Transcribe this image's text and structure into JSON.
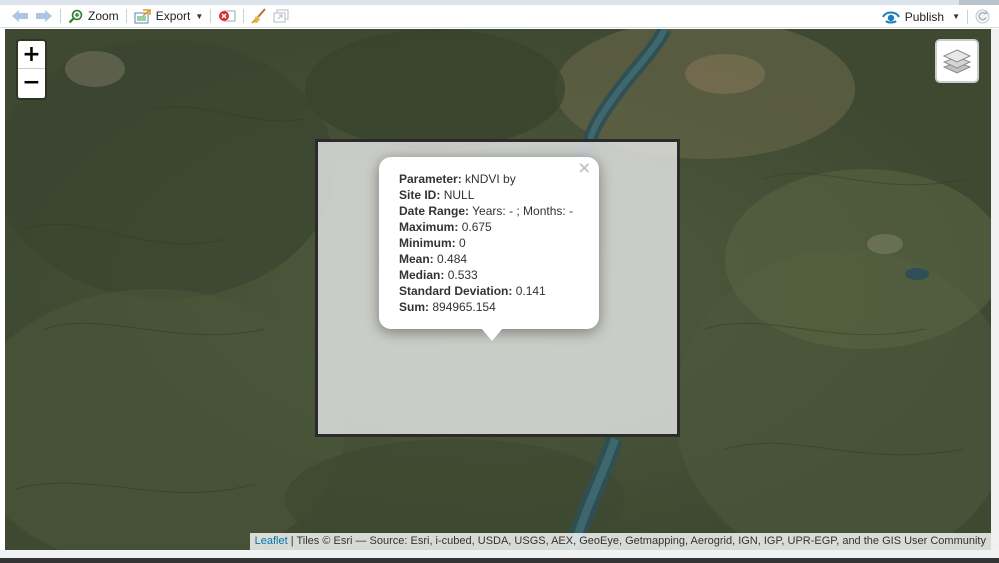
{
  "toolbar": {
    "zoom_label": "Zoom",
    "export_label": "Export",
    "publish_label": "Publish"
  },
  "map": {
    "zoom_in": "+",
    "zoom_out": "−"
  },
  "popup": {
    "close": "×",
    "rows": [
      {
        "label": "Parameter:",
        "value": "kNDVI by"
      },
      {
        "label": "Site ID:",
        "value": "NULL"
      },
      {
        "label": "Date Range:",
        "value": "Years: - ; Months: -"
      },
      {
        "label": "Maximum:",
        "value": "0.675"
      },
      {
        "label": "Minimum:",
        "value": "0"
      },
      {
        "label": "Mean:",
        "value": "0.484"
      },
      {
        "label": "Median:",
        "value": "0.533"
      },
      {
        "label": "Standard Deviation:",
        "value": "0.141"
      },
      {
        "label": "Sum:",
        "value": "894965.154"
      }
    ]
  },
  "attribution": {
    "leaflet": "Leaflet",
    "text": " | Tiles © Esri — Source: Esri, i-cubed, USDA, USGS, AEX, GeoEye, Getmapping, Aerogrid, IGN, IGP, UPR-EGP, and the GIS User Community"
  },
  "colors": {
    "accent": "#1a7fc1",
    "polygon_border": "#2b2b2b",
    "link": "#0078a8"
  },
  "icons": [
    "back-arrow-icon",
    "forward-arrow-icon",
    "zoom-magnifier-icon",
    "export-icon",
    "clear-icon",
    "brush-icon",
    "popout-icon",
    "publish-icon",
    "refresh-icon",
    "layers-icon"
  ]
}
